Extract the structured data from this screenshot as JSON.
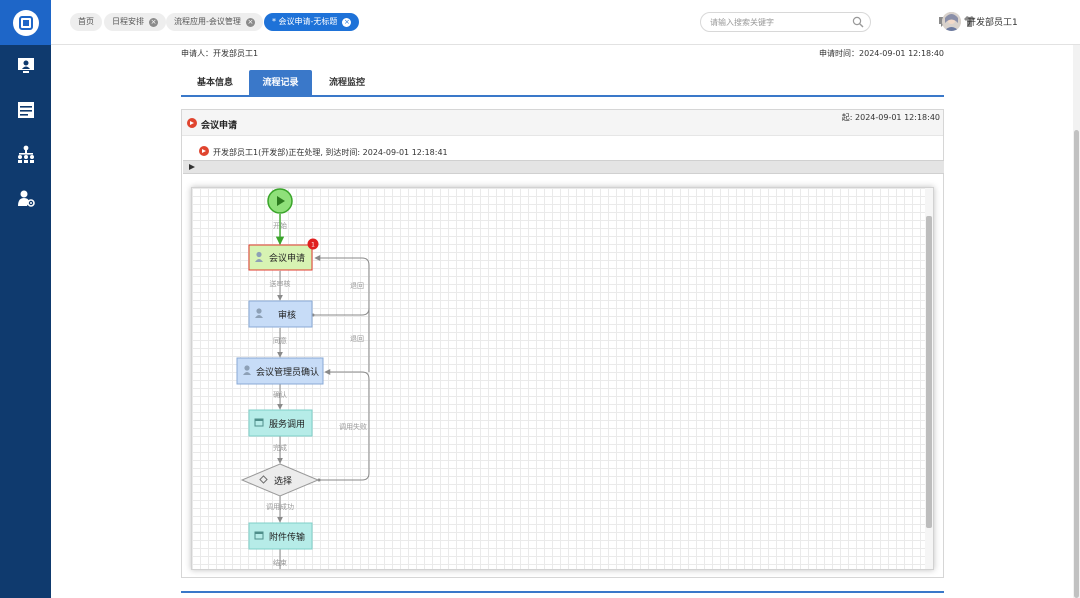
{
  "topbar": {
    "tabs": [
      {
        "label": "首页",
        "closable": false
      },
      {
        "label": "日程安排",
        "closable": true
      },
      {
        "label": "流程应用-会议管理",
        "closable": true
      },
      {
        "label": "* 会议申请-无标题",
        "closable": true,
        "active": true
      }
    ],
    "search_placeholder": "请输入搜索关键字",
    "username": "开发部员工1"
  },
  "form": {
    "applicant": "申请人：开发部员工1",
    "apply_time": "申请时间：2024-09-01 12:18:40",
    "tabs": [
      "基本信息",
      "流程记录",
      "流程监控"
    ],
    "active_tab": "流程记录"
  },
  "panel": {
    "title": "会议申请",
    "start_time": "起: 2024-09-01 12:18:40",
    "status": "开发部员工1(开发部)正在处理, 到达时间: 2024-09-01 12:18:41"
  },
  "flow": {
    "start_label": "开始",
    "end_label": "结束",
    "nodes": {
      "apply": "会议申请",
      "review": "审核",
      "admin": "会议管理员确认",
      "service": "服务调用",
      "choice": "选择",
      "attach": "附件传输"
    },
    "badge": "1",
    "edges": {
      "send_review": "送审核",
      "agree": "同意",
      "confirm": "确认",
      "done": "完成",
      "call_success": "调用成功",
      "back1": "退回",
      "back2": "退回",
      "call_fail": "调用失败"
    }
  },
  "colors": {
    "sidebar": "#0f3a6e",
    "accent": "#1e72d8",
    "current_node": "#d7f3b3",
    "current_border": "#e23b2e",
    "user_node": "#c7dcf7",
    "service_node": "#b6ece8",
    "start_node": "#8fe07a"
  }
}
